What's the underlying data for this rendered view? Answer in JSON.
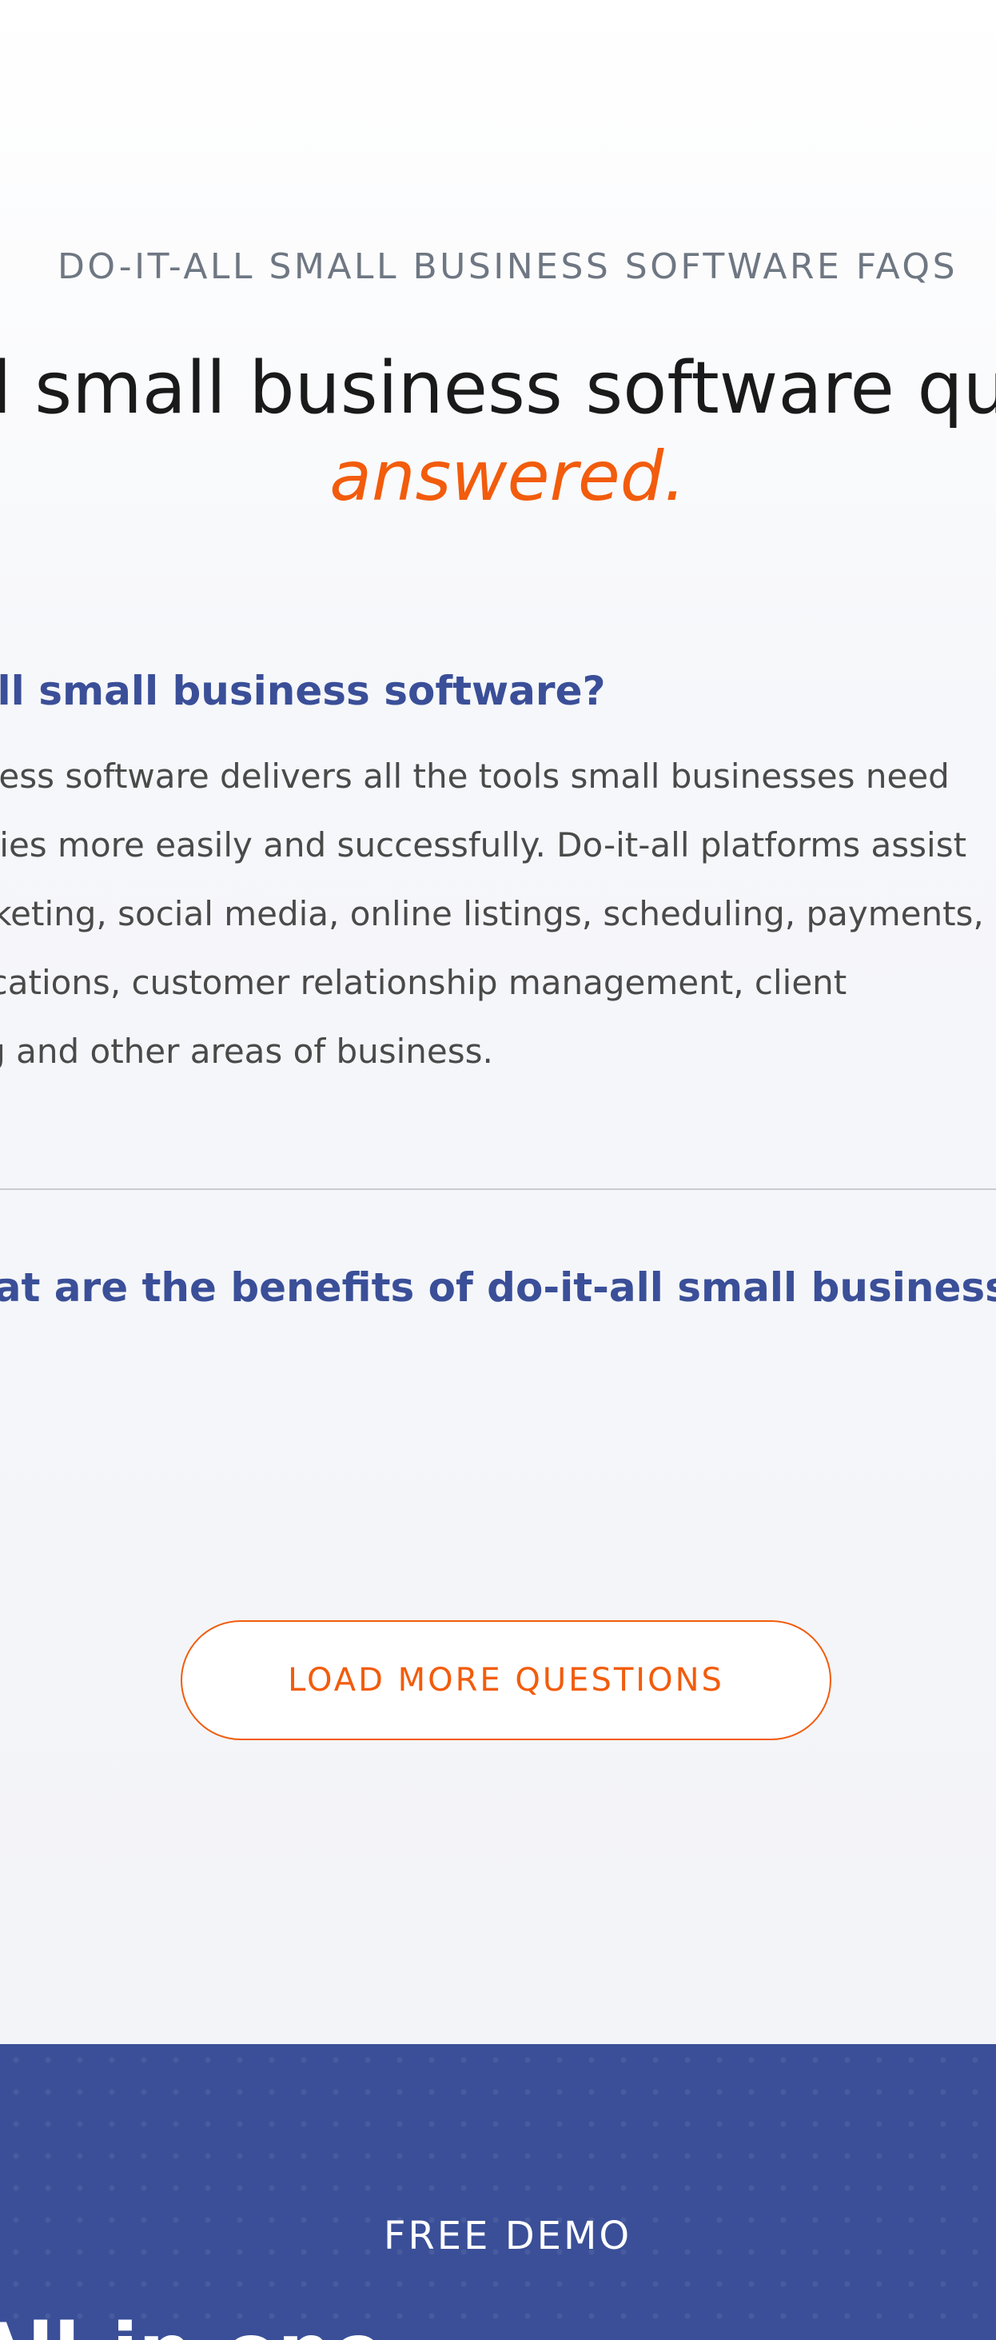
{
  "faq": {
    "eyebrow": "DO-IT-ALL SMALL BUSINESS SOFTWARE FAQS",
    "headline": "Do-it-all small business software questions,",
    "headline_accent": "answered.",
    "items": [
      {
        "question": "What is do-it-all small business software?",
        "answer": "Do-it-all small business software delivers all the tools small businesses need\nto run their companies more easily and successfully. Do-it-all platforms assist\nwith managing marketing, social media, online listings, scheduling, payments,\ncustomer communications, customer relationship management, client\npayment processing and other areas of business."
      },
      {
        "question": "What are the benefits of do-it-all small business software?"
      }
    ],
    "load_more_label": "LOAD MORE QUESTIONS"
  },
  "demo": {
    "eyebrow": "FREE DEMO",
    "headline": "All-in-one"
  },
  "colors": {
    "accent": "#f25c0c",
    "brand_blue": "#3a4f98",
    "eyebrow_gray": "#6e7782"
  }
}
